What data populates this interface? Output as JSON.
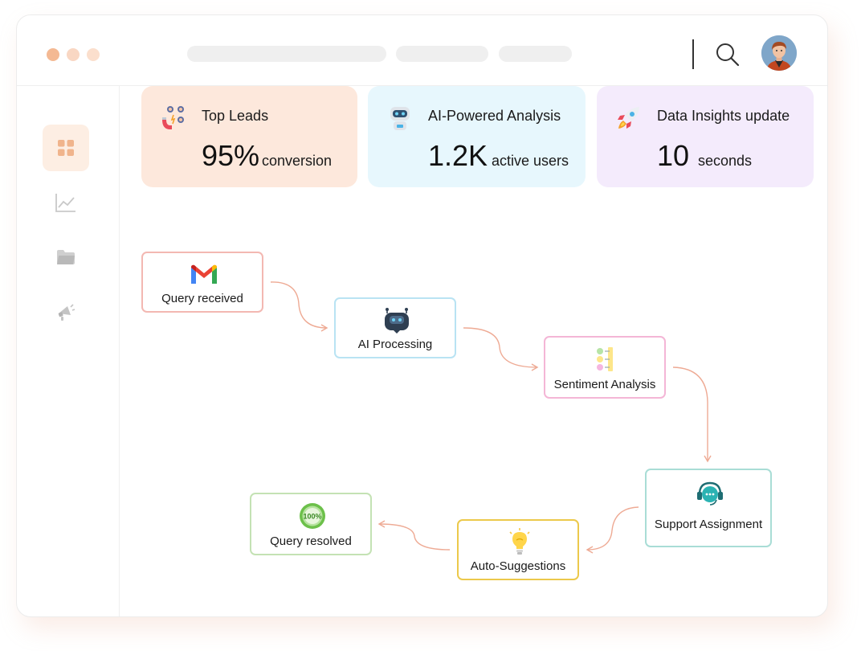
{
  "window": {
    "dots": [
      "#f4b993",
      "#f9d7c3",
      "#fbdfcd"
    ]
  },
  "header": {
    "search_icon": "search-icon",
    "avatar": "user-avatar"
  },
  "sidebar": {
    "items": [
      {
        "icon": "dashboard-grid-icon",
        "active": true
      },
      {
        "icon": "line-chart-icon",
        "active": false
      },
      {
        "icon": "folder-icon",
        "active": false
      },
      {
        "icon": "megaphone-icon",
        "active": false
      }
    ]
  },
  "cards": [
    {
      "title": "Top Leads",
      "value": "95%",
      "unit": "conversion",
      "icon": "magnet-users-icon",
      "bg": "#fde8dc"
    },
    {
      "title": "AI-Powered Analysis",
      "value": "1.2K",
      "unit": "active users",
      "icon": "robot-icon",
      "bg": "#e7f7fd"
    },
    {
      "title": "Data Insights update",
      "value": "10",
      "unit": "seconds",
      "icon": "rocket-icon",
      "bg": "#f4ebfc"
    }
  ],
  "flow": {
    "nodes": [
      {
        "label": "Query received",
        "icon": "gmail-icon",
        "border": "#f3b8b2"
      },
      {
        "label": "AI Processing",
        "icon": "robot-chat-icon",
        "border": "#b9e3f3"
      },
      {
        "label": "Sentiment Analysis",
        "icon": "sentiment-list-icon",
        "border": "#f4b6d6"
      },
      {
        "label": "Support Assignment",
        "icon": "headset-chat-icon",
        "border": "#a9ddd6"
      },
      {
        "label": "Auto-Suggestions",
        "icon": "lightbulb-icon",
        "border": "#ecc94b"
      },
      {
        "label": "Query resolved",
        "icon": "100-percent-icon",
        "border": "#c4e2b4"
      }
    ],
    "arrow_color": "#eeaa94"
  }
}
